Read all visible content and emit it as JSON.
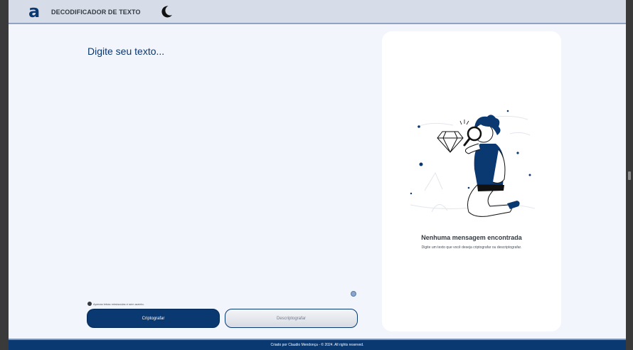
{
  "header": {
    "logo": "a",
    "title": "DECODIFICADOR DE TEXTO",
    "theme_icon": "moon-icon"
  },
  "input": {
    "placeholder": "Digite seu texto...",
    "value": ""
  },
  "warning": {
    "icon": "info-icon",
    "text": "Apenas letras minúsculas e sem acento."
  },
  "buttons": {
    "encrypt_label": "Criptografar",
    "decrypt_label": "Descriptografar"
  },
  "result": {
    "illustration": "person-magnifier-illustration",
    "title": "Nenhuma mensagem encontrada",
    "subtitle": "Digite um texto que você deseja criptografar ou descriptografar."
  },
  "footer": {
    "text": "Criado por Claudio Mendonça - © 2024. All rights reserved."
  },
  "colors": {
    "primary": "#0a3871",
    "background": "#f3f5fc",
    "header": "#d6dce8",
    "panel": "#ffffff"
  }
}
